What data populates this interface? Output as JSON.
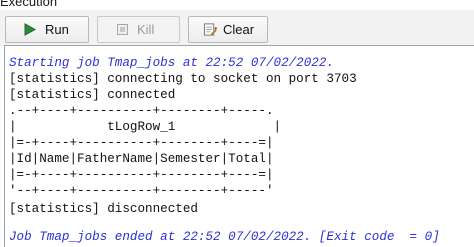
{
  "panel": {
    "title": "Execution"
  },
  "toolbar": {
    "run_label": "Run",
    "kill_label": "Kill",
    "clear_label": "Clear"
  },
  "icons": {
    "run": "play-triangle-icon",
    "kill": "stop-square-icon",
    "clear": "clear-console-icon"
  },
  "colors": {
    "run_icon": "#2e8b3a",
    "status_text": "#2a32d6",
    "console_text": "#111111"
  },
  "console": {
    "lines": [
      "Starting job Tmap_jobs at 22:52 07/02/2022.",
      "[statistics] connecting to socket on port 3703",
      "[statistics] connected",
      ".--+----+----------+--------+-----.",
      "|            tLogRow_1             |",
      "|=-+----+----------+--------+----=|",
      "|Id|Name|FatherName|Semester|Total|",
      "|=-+----+----------+--------+----=|",
      "'--+----+----------+--------+-----'",
      "[statistics] disconnected",
      "Job Tmap_jobs ended at 22:52 07/02/2022. [Exit code  = 0]"
    ]
  }
}
